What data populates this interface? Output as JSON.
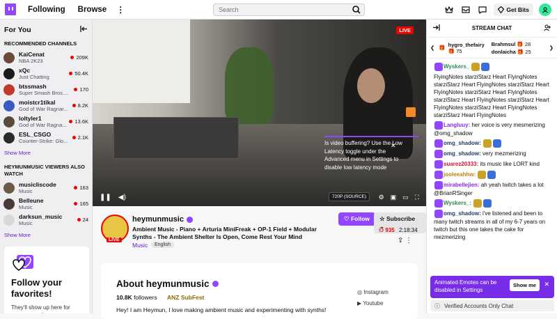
{
  "nav": {
    "following": "Following",
    "browse": "Browse",
    "search_placeholder": "Search",
    "get_bits": "Get Bits"
  },
  "sidebar": {
    "title": "For You",
    "recommended_title": "RECOMMENDED CHANNELS",
    "recommended": [
      {
        "name": "KaiCenat",
        "game": "NBA 2K23",
        "viewers": "209K",
        "color": "#6b4a3a"
      },
      {
        "name": "xQc",
        "game": "Just Chatting",
        "viewers": "50.4K",
        "color": "#1b1b1b"
      },
      {
        "name": "btssmash",
        "game": "Super Smash Bros....",
        "viewers": "170",
        "color": "#c0392b"
      },
      {
        "name": "moistcr1tikal",
        "game": "God of War Ragnar...",
        "viewers": "8.2K",
        "color": "#3a5bbf"
      },
      {
        "name": "loltyler1",
        "game": "God of War Ragna...",
        "viewers": "13.6K",
        "color": "#5a4a3a"
      },
      {
        "name": "ESL_CSGO",
        "game": "Counter-Strike: Glo...",
        "viewers": "2.1K",
        "color": "#2b2b2b"
      }
    ],
    "show_more": "Show More",
    "also_watch_title": "HEYMUNMUSIC VIEWERS ALSO WATCH",
    "also_watch": [
      {
        "name": "musicliscode",
        "game": "Music",
        "viewers": "163",
        "color": "#6c5a4a"
      },
      {
        "name": "Belleune",
        "game": "Music",
        "viewers": "165",
        "color": "#4a3a3a"
      },
      {
        "name": "darksun_music",
        "game": "Music",
        "viewers": "24",
        "color": "#d8d8d8"
      }
    ],
    "show_more_2": "Show More",
    "follow_title": "Follow your favorites!",
    "follow_sub": "They'll show up here for easy access!"
  },
  "video": {
    "live": "LIVE",
    "buffer_tip": "Is video buffering? Use the Low Latency toggle under the Advanced menu in Settings to disable low latency mode",
    "quality": "720P (SOURCE)"
  },
  "stream": {
    "name": "heymunmusic",
    "live_badge": "LIVE",
    "title": "Ambient Music - Piano + Arturia MiniFreak + OP-1 Field + Modular Synths - The Ambient Shelter Is Open, Come Rest Your Mind",
    "category": "Music",
    "tag": "English",
    "follow": "Follow",
    "subscribe": "Subscribe",
    "viewers": "935",
    "uptime": "2:18:34",
    "about_title": "About heymunmusic",
    "followers_count": "10.8K",
    "followers_label": "followers",
    "subfest": "ANZ SubFest",
    "bio": "Hey! I am Heymun, I love making ambient music and experimenting with synths!",
    "instagram": "Instagram",
    "youtube": "Youtube"
  },
  "chat": {
    "title": "STREAM CHAT",
    "pinned": [
      {
        "user": "hygro_thefairy",
        "count": "75"
      },
      {
        "user": "Brahmsul",
        "count": "28"
      },
      {
        "user": "donlaicha",
        "count": "25"
      }
    ],
    "messages": [
      {
        "user": "Wyskers_",
        "text": "",
        "color": "#2e8b57"
      },
      {
        "user": "",
        "text": "FlyingNotes starziStarz Heart FlyingNotes starziStarz Heart FlyingNotes starziStarz Heart FlyingNotes starziStarz Heart FlyingNotes starziStarz Heart FlyingNotes starziStarz Heart FlyingNotes starziStarz Heart FlyingNotes starziStarz Heart FlyingNotes",
        "color": "#000"
      },
      {
        "user": "Langluuy:",
        "text": "her voice is very mesmerizing @omg_shadow",
        "color": "#8a2be2"
      },
      {
        "user": "omg_shadow:",
        "text": "",
        "color": "#1e3a5f"
      },
      {
        "user": "omg_shadow:",
        "text": "very mezmerizing",
        "color": "#1e3a5f"
      },
      {
        "user": "suarez20333:",
        "text": "its music like LORT kind",
        "color": "#d2143a"
      },
      {
        "user": "jooleeahhw:",
        "text": "",
        "color": "#b8860b"
      },
      {
        "user": "mirabellejien:",
        "text": "ah yeah twitch takes a lot @BrianRSinger",
        "color": "#8a2be2"
      },
      {
        "user": "Wyskers_:",
        "text": "",
        "color": "#2e8b57"
      },
      {
        "user": "omg_shadow:",
        "text": "i've listened and been to many twitch streams in all of my 6-7 years on twitch but this one takes the cake for mezmerizing",
        "color": "#1e3a5f"
      }
    ],
    "banner_text": "Animated Emotes can be disabled in Settings",
    "show_me": "Show me",
    "verified_only": "Verified Accounts Only Chat"
  }
}
